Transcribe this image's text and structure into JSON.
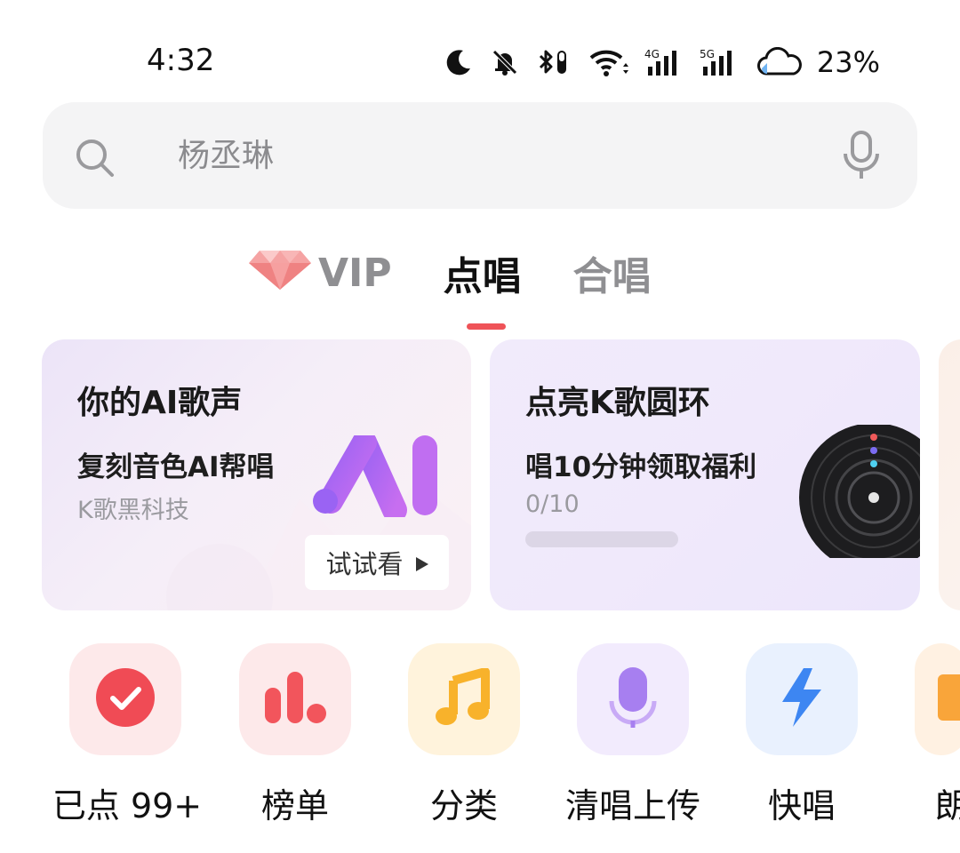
{
  "status_bar": {
    "time": "4:32",
    "battery": "23%",
    "network_1": "4G",
    "network_2": "5G",
    "icons": [
      "moon-icon",
      "bell-off-icon",
      "bluetooth-icon",
      "wifi-icon",
      "signal-4g-icon",
      "signal-5g-icon",
      "cloud-battery-icon"
    ]
  },
  "search": {
    "placeholder": "杨丞琳"
  },
  "tabs": [
    {
      "label": "VIP",
      "active": false
    },
    {
      "label": "点唱",
      "active": true
    },
    {
      "label": "合唱",
      "active": false
    }
  ],
  "cards": [
    {
      "title": "你的AI歌声",
      "subtitle": "复刻音色AI帮唱",
      "note": "K歌黑科技",
      "button": "试试看"
    },
    {
      "title": "点亮K歌圆环",
      "subtitle": "唱10分钟领取福利",
      "progress_text": "0/10",
      "progress_fraction": 0
    }
  ],
  "quick_actions": [
    {
      "label": "已点 99+",
      "icon": "check-circle-icon",
      "color": "#f04b55"
    },
    {
      "label": "榜单",
      "icon": "chart-bars-icon",
      "color": "#f2555c"
    },
    {
      "label": "分类",
      "icon": "music-note-icon",
      "color": "#f8b22b"
    },
    {
      "label": "清唱上传",
      "icon": "microphone-icon",
      "color": "#a77ff0"
    },
    {
      "label": "快唱",
      "icon": "lightning-icon",
      "color": "#3d86f2"
    },
    {
      "label": "朗",
      "icon": "book-icon",
      "color": "#f9a53a"
    }
  ],
  "colors": {
    "accent": "#ef5358"
  }
}
